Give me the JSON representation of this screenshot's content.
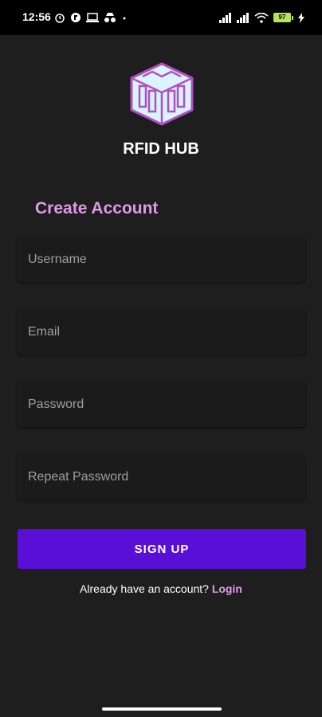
{
  "status_bar": {
    "time": "12:56",
    "left_icons": [
      "alarm-icon",
      "app-notification-icon",
      "cast-icon",
      "incognito-icon",
      "dot-icon"
    ],
    "right_icons": [
      "signal-icon",
      "signal-icon",
      "wifi-icon",
      "battery-icon",
      "charging-icon"
    ],
    "battery": "97"
  },
  "brand": {
    "name": "RFID HUB",
    "colors": {
      "logo_fill": "#d9f4ff",
      "logo_stroke": "#b04fc3"
    }
  },
  "form": {
    "title": "Create Account",
    "fields": {
      "username": {
        "placeholder": "Username"
      },
      "email": {
        "placeholder": "Email"
      },
      "password": {
        "placeholder": "Password"
      },
      "repeat_password": {
        "placeholder": "Repeat Password"
      }
    },
    "submit_label": "SIGN UP"
  },
  "footer": {
    "prompt": "Already have an account?",
    "login_label": "Login"
  },
  "colors": {
    "background": "#1e1e1e",
    "accent": "#5a0fd6",
    "title": "#df9ae8"
  }
}
